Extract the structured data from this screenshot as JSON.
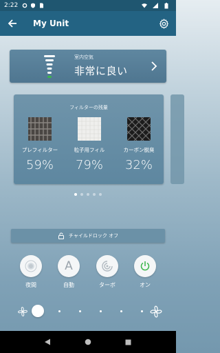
{
  "status_bar": {
    "time": "2:22"
  },
  "app_bar": {
    "title": "My Unit"
  },
  "air_quality": {
    "label": "室内空気",
    "value": "非常に良い"
  },
  "filters": {
    "title": "フィルターの残量",
    "items": [
      {
        "name": "プレフィルター",
        "percent": "59%"
      },
      {
        "name": "粒子用フィル",
        "percent": "79%"
      },
      {
        "name": "カーボン脱臭",
        "percent": "32%"
      }
    ]
  },
  "pager": {
    "count": 5,
    "active_index": 0
  },
  "child_lock": {
    "label": "チャイルドロック オフ"
  },
  "modes": [
    {
      "label": "夜間",
      "icon": "night-icon"
    },
    {
      "label": "自動",
      "icon": "auto-icon",
      "glyph": "A"
    },
    {
      "label": "ターボ",
      "icon": "turbo-icon"
    },
    {
      "label": "オン",
      "icon": "power-icon"
    }
  ],
  "fan_speed": {
    "level": 1,
    "steps": 6
  },
  "colors": {
    "status_bar": "#1f5670",
    "app_bar": "#236383",
    "power_green": "#3bb54a"
  }
}
